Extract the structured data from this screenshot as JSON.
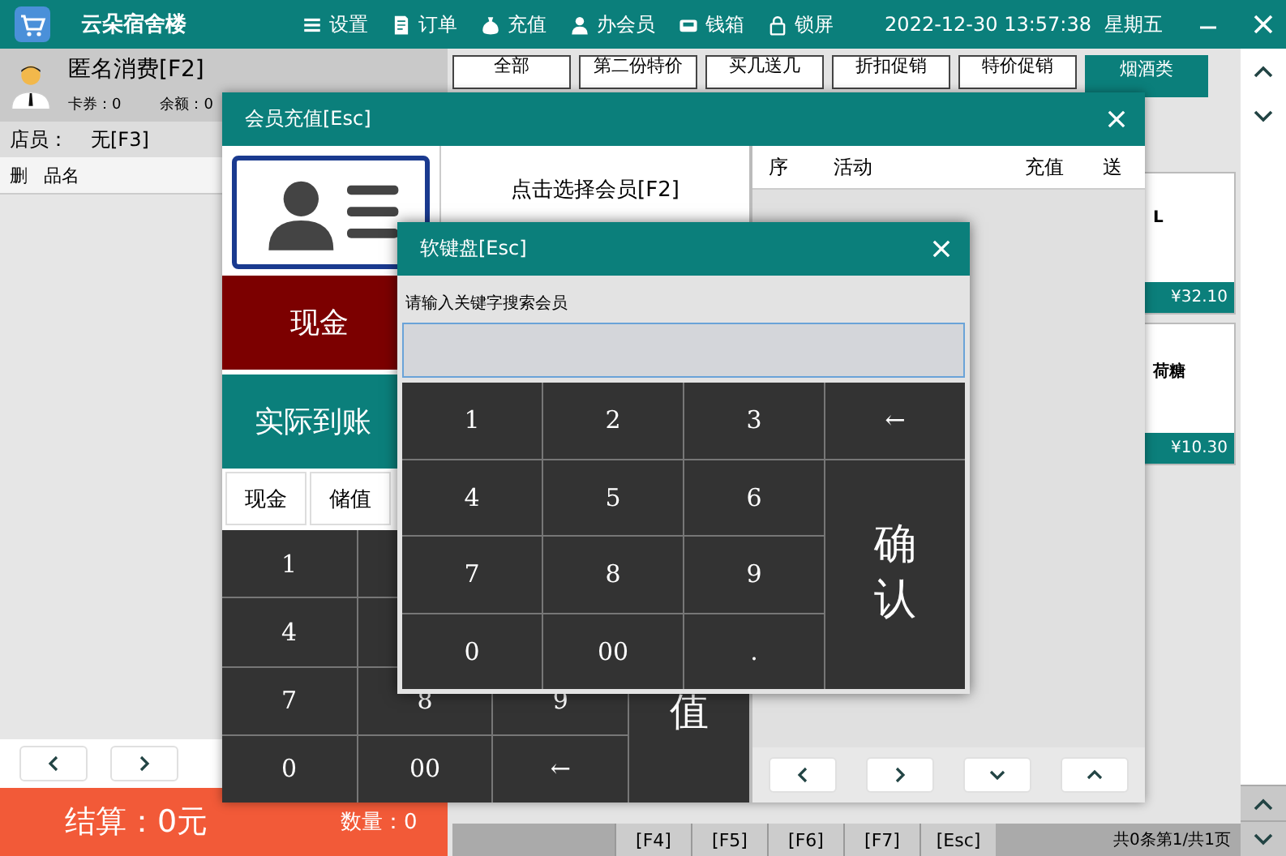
{
  "header": {
    "app_name": "云朵宿舍楼",
    "menu": [
      {
        "label": "设置",
        "kind": "menu"
      },
      {
        "label": "订单",
        "kind": "doc"
      },
      {
        "label": "充值",
        "kind": "bag"
      },
      {
        "label": "办会员",
        "kind": "user"
      },
      {
        "label": "钱箱",
        "kind": "box"
      },
      {
        "label": "锁屏",
        "kind": "lock"
      }
    ],
    "datetime": "2022-12-30 13:57:38",
    "weekday": "星期五"
  },
  "member": {
    "name": "匿名消费[F2]",
    "coupons": "卡券：0",
    "balance": "余额：0"
  },
  "clerk": {
    "label": "店员：",
    "value": "无[F3]"
  },
  "order_table": {
    "columns": [
      "删",
      "品名"
    ]
  },
  "checkout": {
    "total": "结算：0元",
    "quantity": "数量：0"
  },
  "category_tabs": [
    {
      "label": "全部",
      "selected": false
    },
    {
      "label": "第二份特价",
      "selected": false
    },
    {
      "label": "买几送几",
      "selected": false
    },
    {
      "label": "折扣促销",
      "selected": false
    },
    {
      "label": "特价促销",
      "selected": false
    },
    {
      "label": "烟酒类",
      "selected": true
    }
  ],
  "products": [
    {
      "name": "L",
      "price": "¥32.10"
    },
    {
      "name": "荷糖",
      "price": "¥10.30"
    }
  ],
  "function_keys": [
    "[F4]",
    "[F5]",
    "[F6]",
    "[F7]",
    "[Esc]"
  ],
  "page_info": "共0条第1/共1页",
  "recharge_dialog": {
    "title": "会员充值[Esc]",
    "select_member": "点击选择会员[F2]",
    "cash_label": "现金",
    "received_label": "实际到账",
    "pay_tabs": [
      "现金",
      "储值"
    ],
    "keys": [
      [
        "1"
      ],
      [
        "4"
      ],
      [
        "7",
        "8",
        "9"
      ],
      [
        "0",
        "00",
        "←"
      ]
    ],
    "confirm_key": "值",
    "activity_columns": [
      "序",
      "活动",
      "充值",
      "送"
    ]
  },
  "keyboard_dialog": {
    "title": "软键盘[Esc]",
    "prompt": "请输入关键字搜索会员",
    "keys": [
      [
        "1",
        "2",
        "3",
        "←"
      ],
      [
        "4",
        "5",
        "6"
      ],
      [
        "7",
        "8",
        "9"
      ],
      [
        "0",
        "00",
        "."
      ]
    ],
    "confirm_key": "确认"
  }
}
